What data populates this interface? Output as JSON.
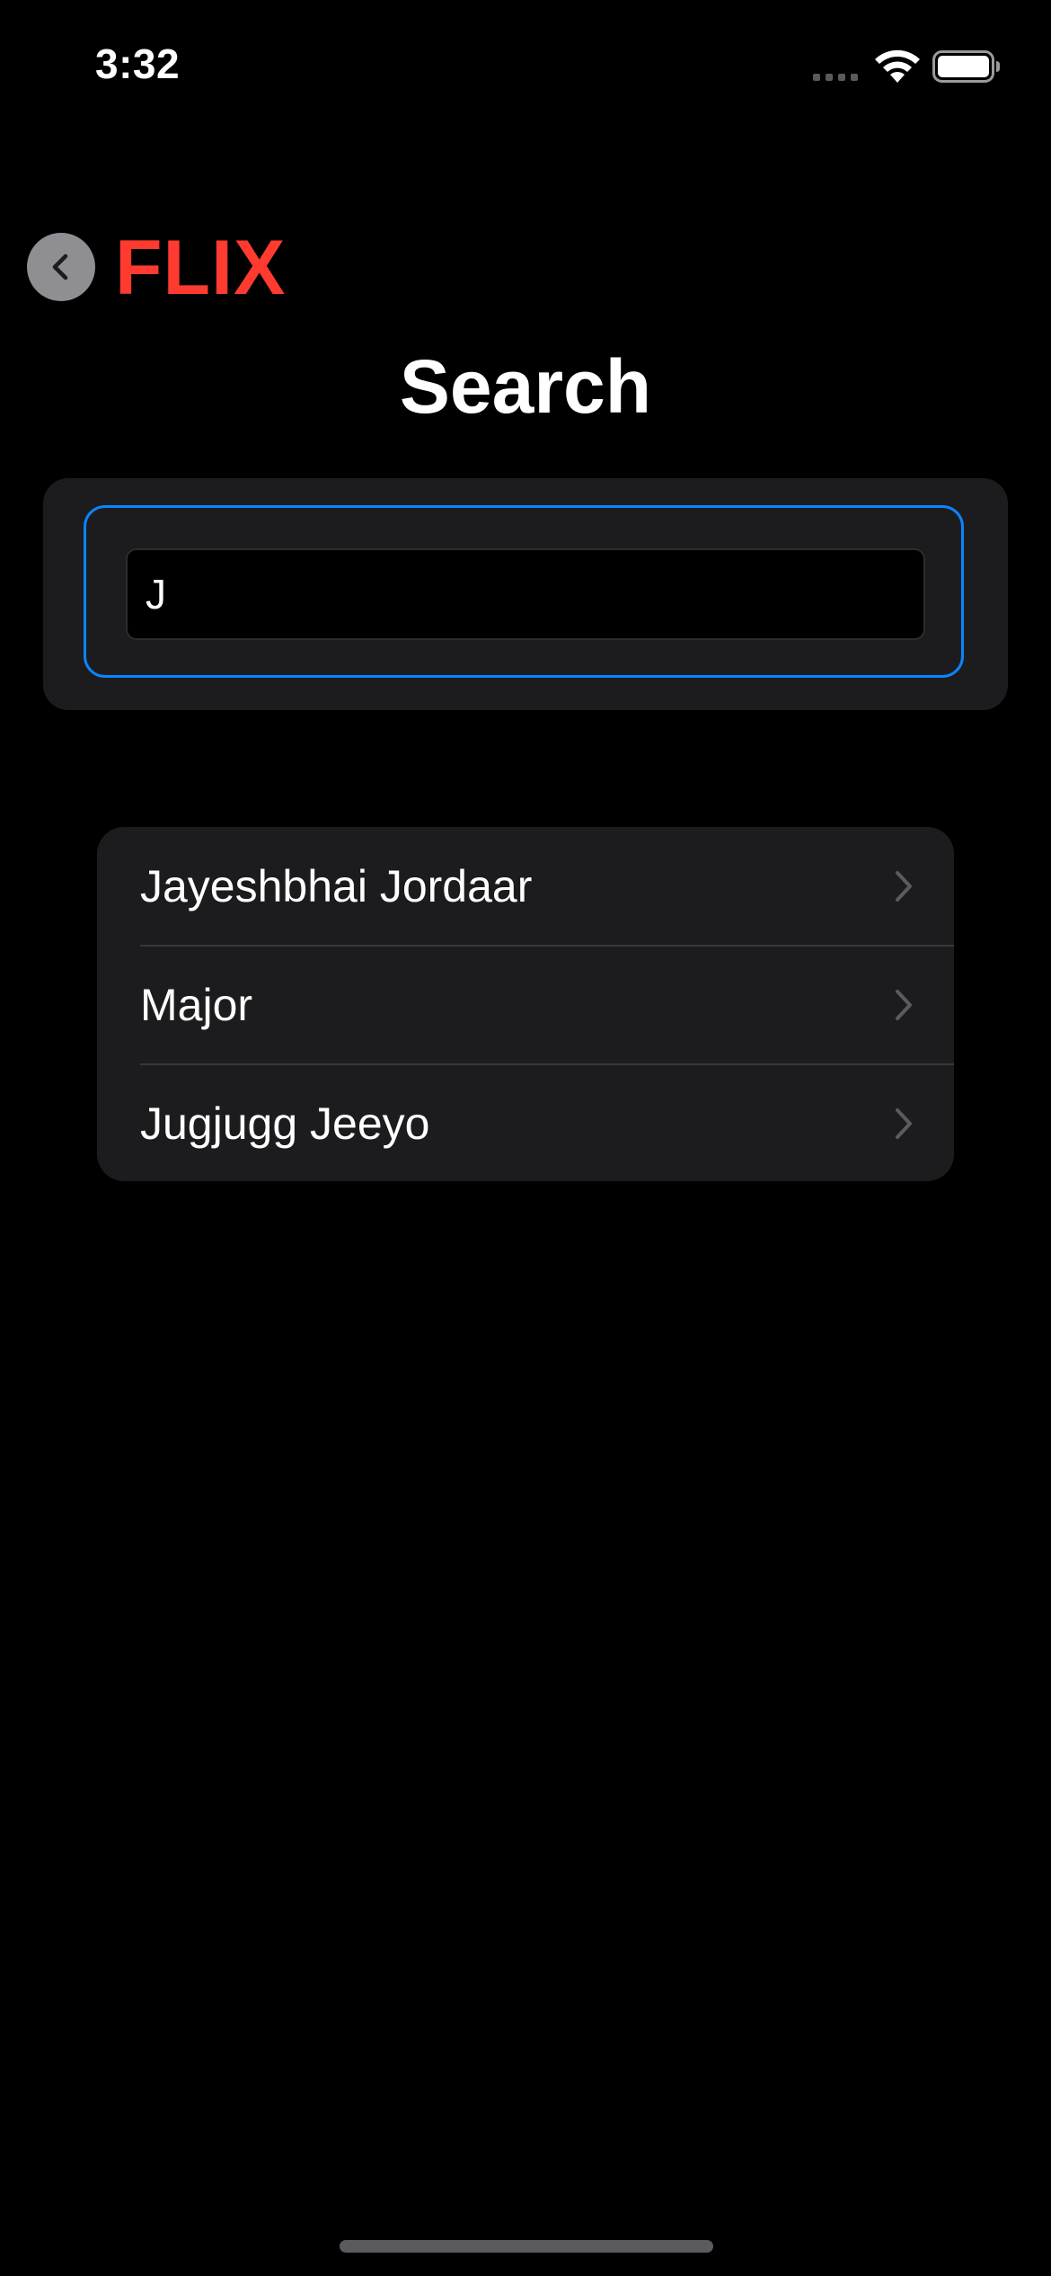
{
  "status_bar": {
    "time": "3:32",
    "icons": [
      "cellular-signal-icon",
      "wifi-icon",
      "battery-icon"
    ]
  },
  "nav": {
    "back_icon": "chevron-left-icon",
    "logo": "FLIX"
  },
  "page": {
    "title": "Search"
  },
  "search": {
    "value": "J",
    "placeholder": ""
  },
  "results": [
    {
      "title": "Jayeshbhai Jordaar"
    },
    {
      "title": "Major"
    },
    {
      "title": "Jugjugg Jeeyo"
    }
  ],
  "colors": {
    "background": "#000000",
    "panel": "#1c1c1e",
    "logo": "#ff3b30",
    "focus_ring": "#0a84ff",
    "back_button": "#8e8e93",
    "chevron": "#5b5b5f"
  }
}
